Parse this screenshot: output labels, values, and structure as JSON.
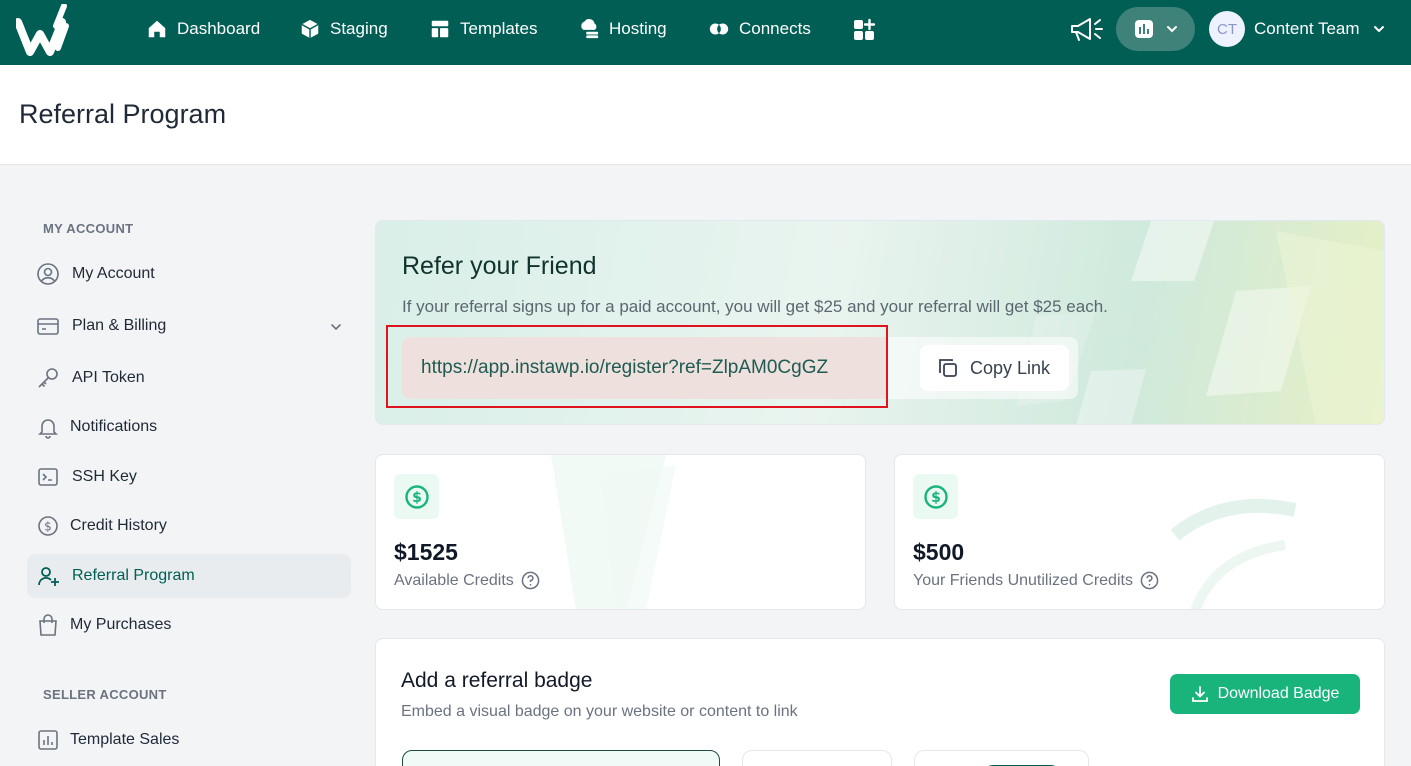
{
  "nav": {
    "items": [
      {
        "label": "Dashboard",
        "icon": "home-icon"
      },
      {
        "label": "Staging",
        "icon": "cube-icon"
      },
      {
        "label": "Templates",
        "icon": "template-icon"
      },
      {
        "label": "Hosting",
        "icon": "cloud-server-icon"
      },
      {
        "label": "Connects",
        "icon": "connects-icon"
      }
    ],
    "user": {
      "initials": "CT",
      "name": "Content Team"
    }
  },
  "page": {
    "title": "Referral Program"
  },
  "sidebar": {
    "my_account_label": "MY ACCOUNT",
    "seller_account_label": "SELLER ACCOUNT",
    "items": [
      {
        "label": "My Account",
        "icon": "user-circle-icon"
      },
      {
        "label": "Plan & Billing",
        "icon": "credit-card-icon"
      },
      {
        "label": "API Token",
        "icon": "key-icon"
      },
      {
        "label": "Notifications",
        "icon": "bell-icon"
      },
      {
        "label": "SSH Key",
        "icon": "terminal-icon"
      },
      {
        "label": "Credit History",
        "icon": "dollar-circle-icon"
      },
      {
        "label": "Referral Program",
        "icon": "user-plus-icon",
        "active": true
      },
      {
        "label": "My Purchases",
        "icon": "shopping-bag-icon"
      }
    ],
    "seller_items": [
      {
        "label": "Template Sales",
        "icon": "bar-chart-icon"
      }
    ]
  },
  "refer": {
    "title": "Refer your Friend",
    "subtitle": "If your referral signs up for a paid account, you will get $25 and your referral will get $25 each.",
    "link": "https://app.instawp.io/register?ref=ZlpAM0CgGZ",
    "copy_label": "Copy Link"
  },
  "stats": [
    {
      "value": "$1525",
      "label": "Available Credits"
    },
    {
      "value": "$500",
      "label": "Your Friends Unutilized Credits"
    }
  ],
  "badge": {
    "title": "Add a referral badge",
    "subtitle": "Embed a visual badge on your website or content to link",
    "download_label": "Download Badge"
  },
  "colors": {
    "brand": "#005e54",
    "accent": "#18b47b",
    "highlight": "#e0141e"
  }
}
